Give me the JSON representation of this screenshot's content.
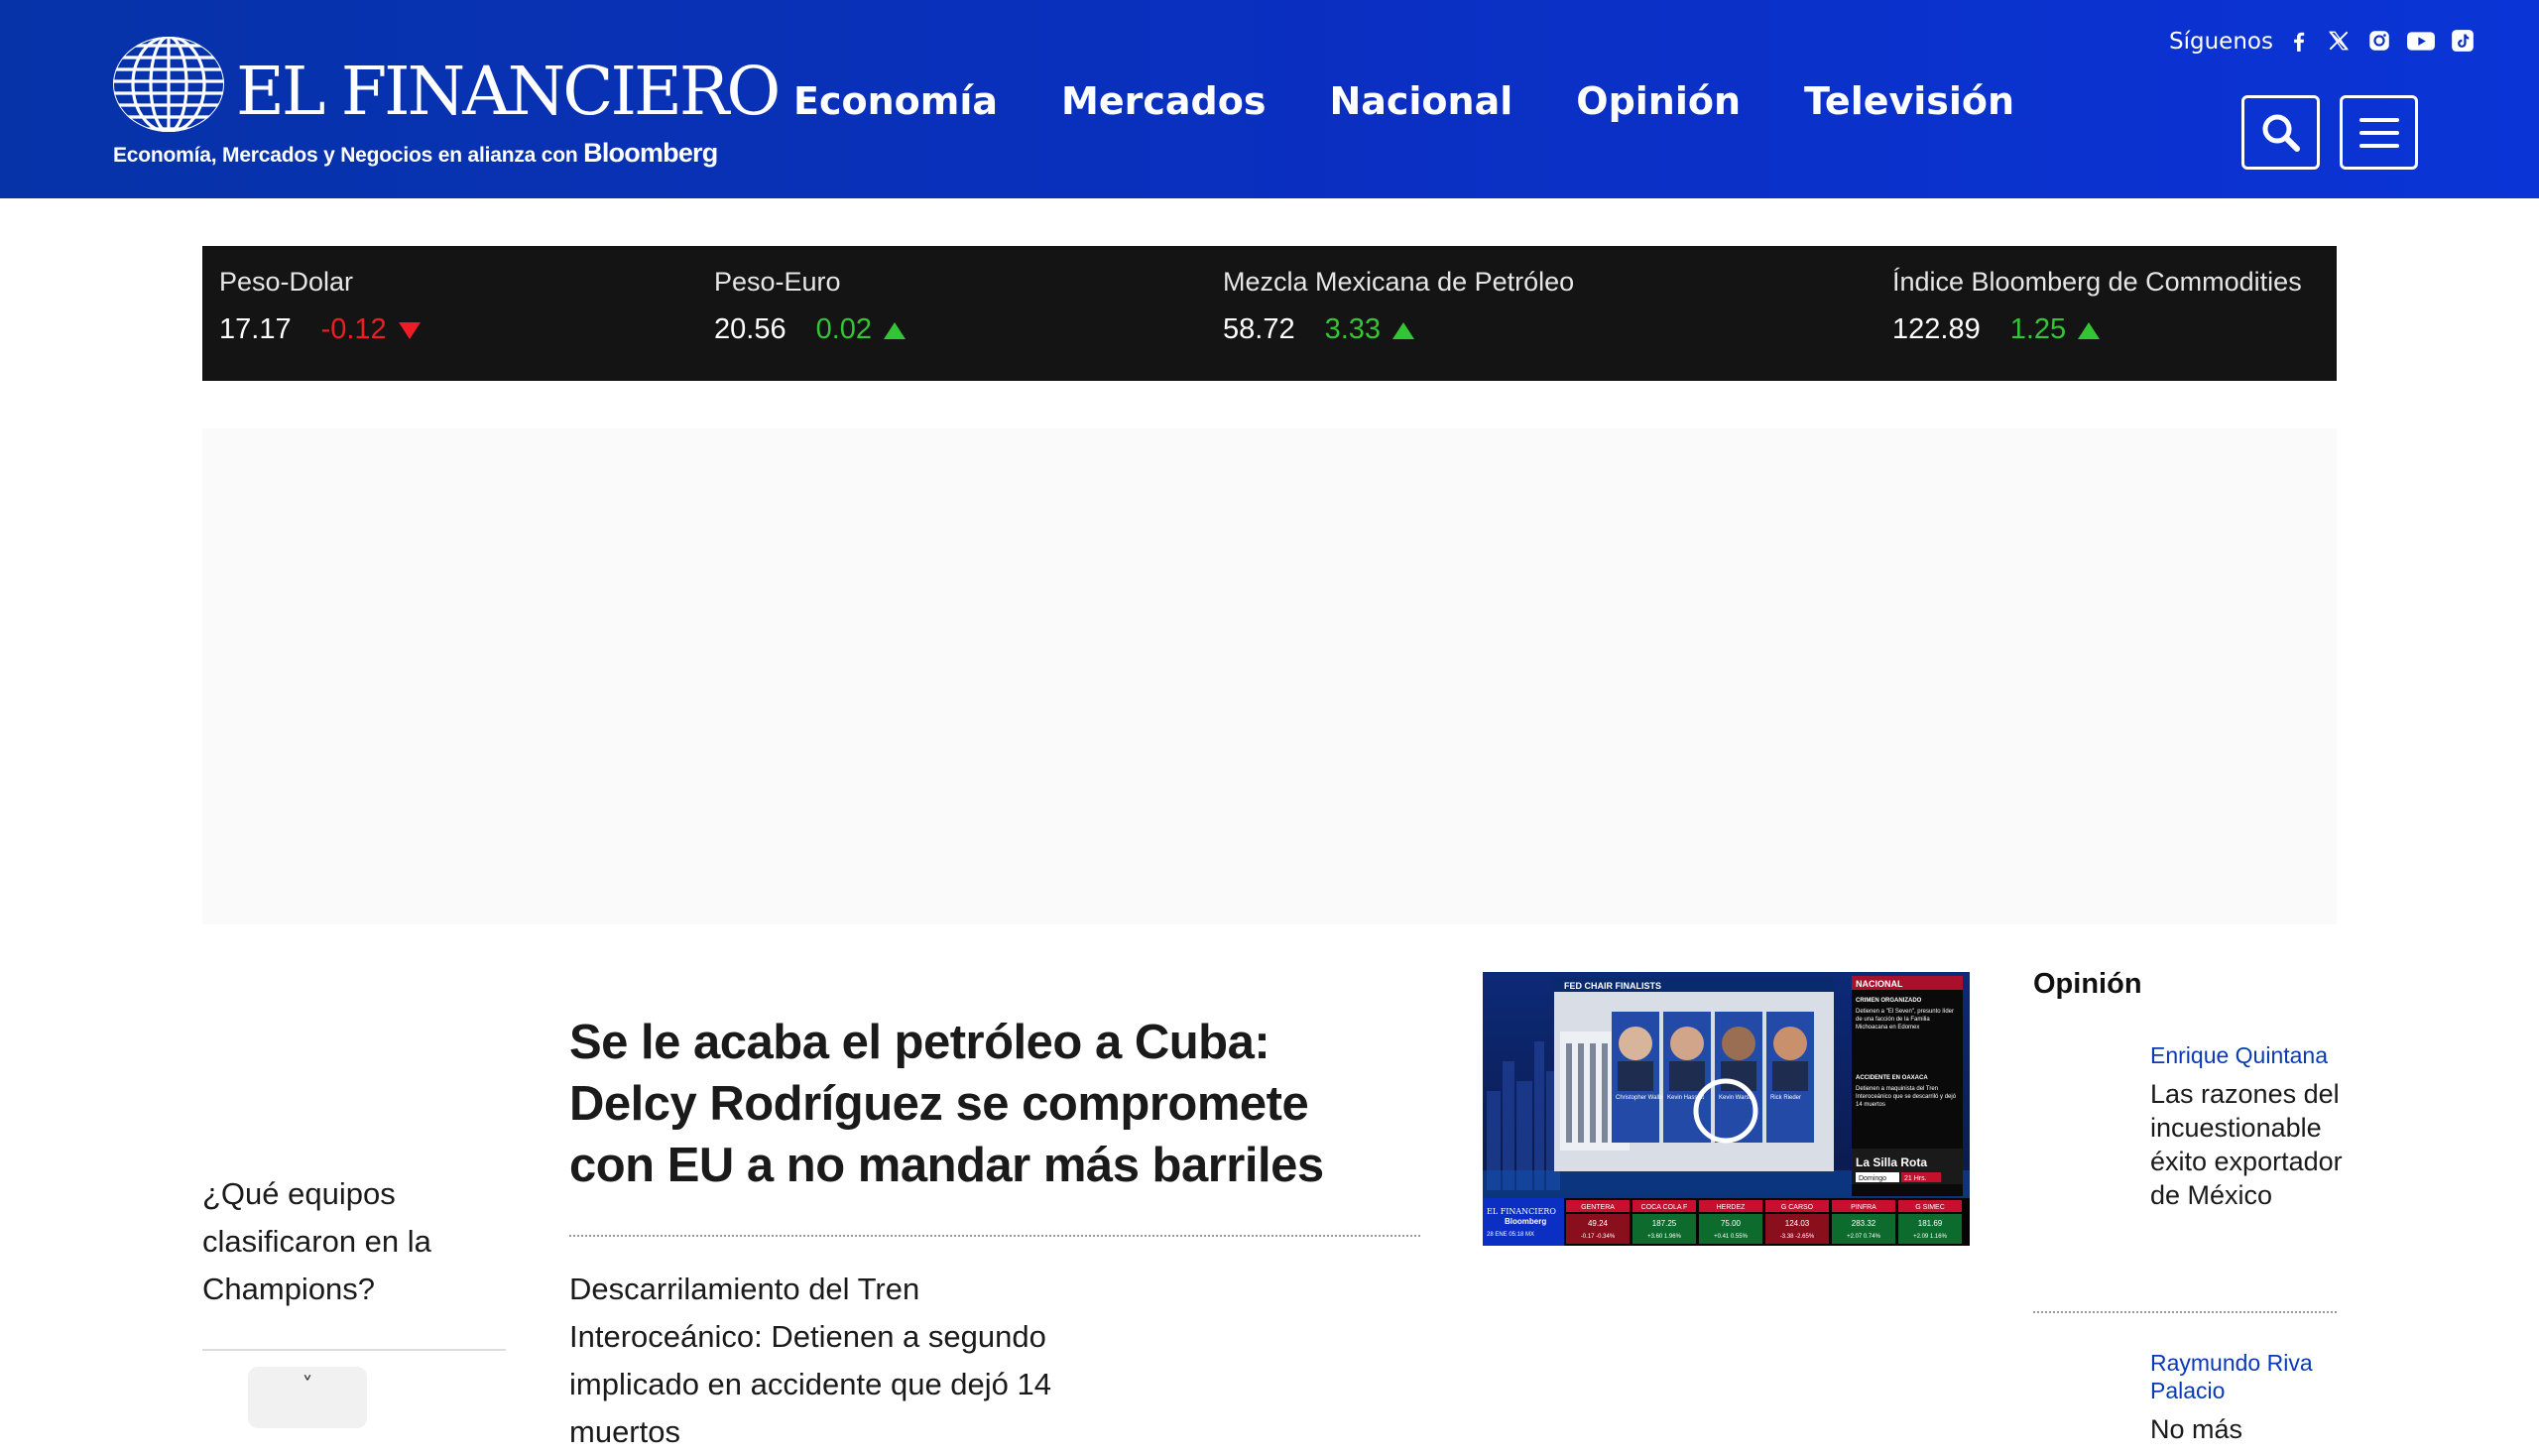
{
  "brand": {
    "name": "EL FINANCIERO",
    "tagline": "Economía, Mercados y Negocios en alianza con",
    "partner": "Bloomberg"
  },
  "nav": [
    "Economía",
    "Mercados",
    "Nacional",
    "Opinión",
    "Televisión"
  ],
  "social": {
    "label": "Síguenos",
    "icons": [
      "facebook-icon",
      "x-icon",
      "instagram-icon",
      "youtube-icon",
      "tiktok-icon"
    ]
  },
  "header_buttons": [
    "search-icon",
    "menu-icon"
  ],
  "ticker": [
    {
      "name": "Peso-Dolar",
      "value": "17.17",
      "change": "-0.12",
      "direction": "down"
    },
    {
      "name": "Peso-Euro",
      "value": "20.56",
      "change": "0.02",
      "direction": "up"
    },
    {
      "name": "Mezcla Mexicana de Petróleo",
      "value": "58.72",
      "change": "3.33",
      "direction": "up"
    },
    {
      "name": "Índice Bloomberg de Commodities",
      "value": "122.89",
      "change": "1.25",
      "direction": "up"
    }
  ],
  "colors": {
    "header_blue": "#0a2fc2",
    "ticker_bg": "#141414",
    "negative": "#ef1c23",
    "positive": "#34c534",
    "link_blue": "#0a3ab4"
  },
  "left_column": {
    "story": "¿Qué equipos clasificaron en la Champions?",
    "toggle": "˅"
  },
  "main": {
    "headline": "Se le acaba el petróleo a Cuba: Delcy Rodríguez se compromete con EU a no mandar más barriles",
    "secondary": "Descarrilamiento del Tren Interoceánico: Detienen a segundo implicado en accidente que dejó 14 muertos"
  },
  "tv_thumbnail": {
    "banner": "FED CHAIR FINALISTS",
    "people": [
      "Christopher Waller",
      "Kevin Hassett",
      "Kevin Warsh",
      "Rick Rieder"
    ],
    "panel_title": "NACIONAL",
    "panel_sub1": "CRIMEN ORGANIZADO",
    "panel_text1": "Detienen a \"El Seven\", presunto líder de una facción de la Familia Michoacana en Edomex",
    "panel_sub2": "ACCIDENTE EN OAXACA",
    "panel_text2": "Detienen a maquinista del Tren Interoceánico que se descarriló y dejó 14 muertos",
    "promo": "La Silla Rota",
    "promo_day": "Domingo",
    "promo_time": "21 Hrs.",
    "logo": "EL FINANCIERO",
    "logo_sub": "Bloomberg",
    "time": "28 ENE 05:18 MX",
    "tickers": [
      {
        "name": "GENTERA",
        "price": "49.24",
        "chg": "-0.17",
        "pct": "-0.34%"
      },
      {
        "name": "COCA COLA F",
        "price": "187.25",
        "chg": "+3.60",
        "pct": "1.96%"
      },
      {
        "name": "HERDEZ",
        "price": "75.00",
        "chg": "+0.41",
        "pct": "0.55%"
      },
      {
        "name": "G CARSO",
        "price": "124.03",
        "chg": "-3.38",
        "pct": "-2.65%"
      },
      {
        "name": "PINFRA",
        "price": "283.32",
        "chg": "+2.07",
        "pct": "0.74%"
      },
      {
        "name": "G SIMEC",
        "price": "181.69",
        "chg": "+2.09",
        "pct": "1.16%"
      }
    ]
  },
  "opinion": {
    "heading": "Opinión",
    "items": [
      {
        "author": "Enrique Quintana",
        "title": "Las razones del incuestionable éxito exportador de México"
      },
      {
        "author": "Raymundo Riva Palacio",
        "title": "No más"
      }
    ]
  }
}
